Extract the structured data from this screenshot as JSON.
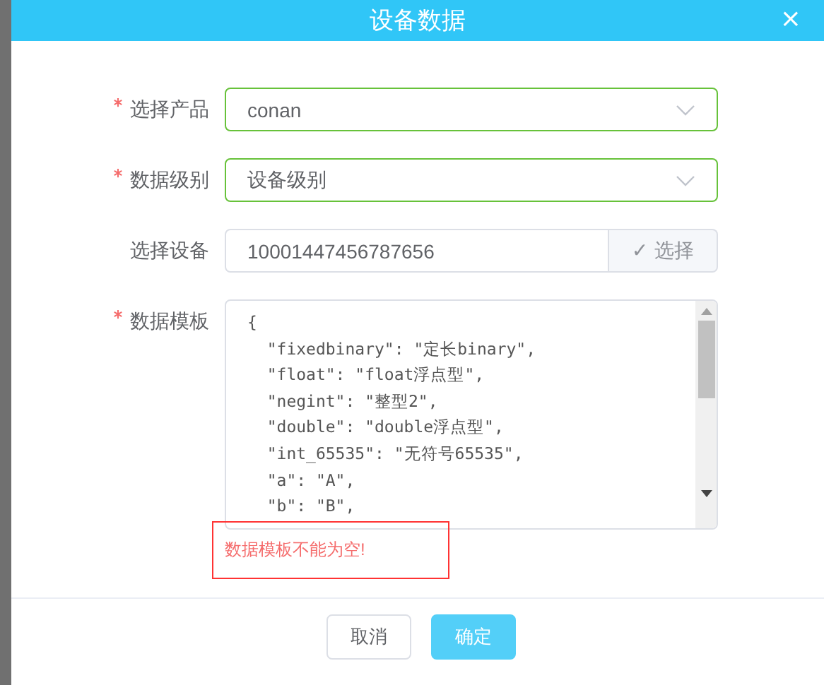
{
  "dialog": {
    "title": "设备数据",
    "close_icon": "×"
  },
  "fields": [
    {
      "kind": "select",
      "label": "选择产品",
      "required": true,
      "valid": true,
      "invalid": false,
      "value": "conan"
    },
    {
      "kind": "select",
      "label": "数据级别",
      "required": true,
      "valid": true,
      "invalid": false,
      "value": "设备级别"
    },
    {
      "kind": "input_button",
      "label": "选择设备",
      "required": false,
      "valid": false,
      "invalid": false,
      "value": "10001447456787656",
      "button": "✓ 选择"
    },
    {
      "kind": "textarea",
      "label": "数据模板",
      "required": true,
      "valid": false,
      "invalid": true,
      "lines": [
        "{",
        "  \"fixedbinary\": \"定长binary\",",
        "  \"float\": \"float浮点型\",",
        "  \"negint\": \"整型2\",",
        "  \"double\": \"double浮点型\",",
        "  \"int_65535\": \"无符号65535\",",
        "  \"a\": \"A\",",
        "  \"b\": \"B\","
      ],
      "error": "数据模板不能为空!"
    }
  ],
  "buttons": [
    {
      "label": "取消",
      "kind": "default"
    },
    {
      "label": "确定",
      "kind": "primary"
    }
  ]
}
